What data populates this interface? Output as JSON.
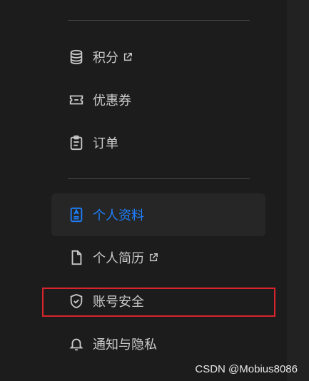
{
  "menu": {
    "items": [
      {
        "label": "积分",
        "icon": "coins-icon",
        "external": true
      },
      {
        "label": "优惠券",
        "icon": "ticket-icon",
        "external": false
      },
      {
        "label": "订单",
        "icon": "clipboard-icon",
        "external": false
      },
      {
        "label": "个人资料",
        "icon": "profile-card-icon",
        "external": false,
        "active": true
      },
      {
        "label": "个人简历",
        "icon": "document-icon",
        "external": true
      },
      {
        "label": "账号安全",
        "icon": "shield-icon",
        "external": false,
        "highlighted": true
      },
      {
        "label": "通知与隐私",
        "icon": "bell-icon",
        "external": false
      }
    ]
  },
  "colors": {
    "background": "#1c1c1c",
    "text": "#c9c9c9",
    "active": "#1e80ff",
    "active_bg": "#262626",
    "highlight_border": "#d8242c"
  },
  "watermark": "CSDN @Mobius8086"
}
